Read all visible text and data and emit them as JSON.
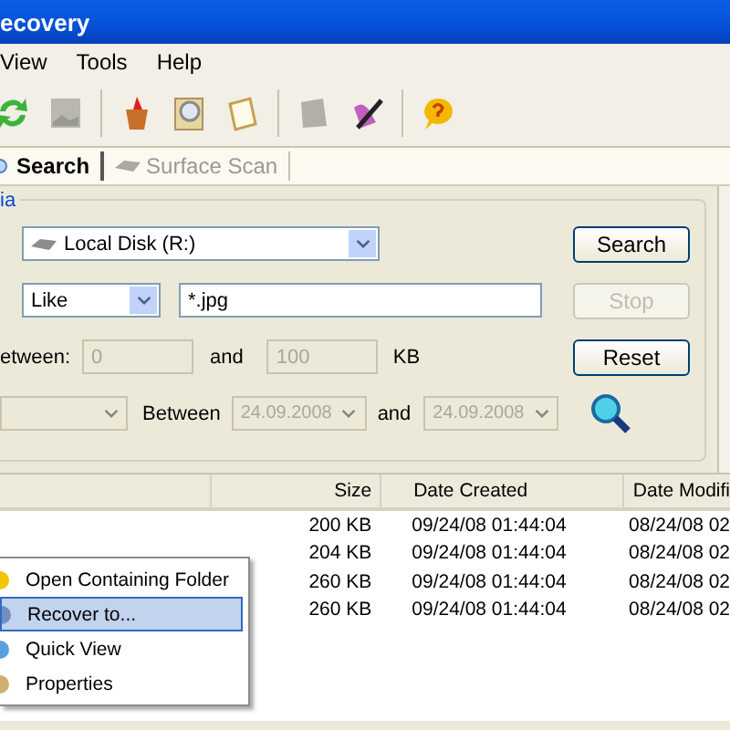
{
  "window": {
    "title": "ecovery"
  },
  "menu": [
    {
      "label": "View"
    },
    {
      "label": "Tools"
    },
    {
      "label": "Help"
    }
  ],
  "tabs": [
    {
      "label": "Search",
      "selected": true
    },
    {
      "label": "Surface Scan",
      "selected": false
    }
  ],
  "criteria": {
    "legend": "ia",
    "drive": "Local Disk (R:)",
    "match": "Like",
    "pattern": "*.jpg",
    "size_label": "etween:",
    "size_min": {
      "value": "0",
      "disabled": true
    },
    "size_and": "and",
    "size_max": {
      "value": "100",
      "disabled": true
    },
    "size_unit": "KB",
    "date_between": "Between",
    "date_from": {
      "value": "24.09.2008",
      "disabled": true
    },
    "date_and": "and",
    "date_to": {
      "value": "24.09.2008",
      "disabled": true
    }
  },
  "buttons": [
    {
      "label": "Search",
      "disabled": false
    },
    {
      "label": "Stop",
      "disabled": true
    },
    {
      "label": "Reset",
      "disabled": false
    }
  ],
  "table": {
    "columns": [
      "Size",
      "Date Created",
      "Date Modifi"
    ],
    "rows": [
      [
        "200 KB",
        "09/24/08 01:44:04",
        "08/24/08 02"
      ],
      [
        "204 KB",
        "09/24/08 01:44:04",
        "08/24/08 02"
      ],
      [
        "260 KB",
        "09/24/08 01:44:04",
        "08/24/08 02"
      ],
      [
        "260 KB",
        "09/24/08 01:44:04",
        "08/24/08 02"
      ]
    ]
  },
  "context_menu": [
    {
      "label": "Open Containing Folder",
      "selected": false
    },
    {
      "label": "Recover to...",
      "selected": true
    },
    {
      "label": "Quick View",
      "selected": false
    },
    {
      "label": "Properties",
      "selected": false
    }
  ]
}
